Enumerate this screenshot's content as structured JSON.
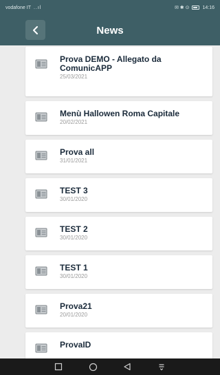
{
  "statusbar": {
    "carrier": "vodafone IT",
    "signal": "..ıl",
    "right_icons": "✉ ✱ ⊙",
    "time": "14:16"
  },
  "appbar": {
    "title": "News",
    "back_icon": "chevron-left-icon"
  },
  "news": [
    {
      "title": "Prova DEMO - Allegato da ComunicAPP",
      "date": "25/03/2021"
    },
    {
      "title": "Menù Hallowen Roma Capitale",
      "date": "20/02/2021"
    },
    {
      "title": "Prova all",
      "date": "31/01/2021"
    },
    {
      "title": "TEST 3",
      "date": "30/01/2020"
    },
    {
      "title": "TEST 2",
      "date": "30/01/2020"
    },
    {
      "title": "TEST 1",
      "date": "30/01/2020"
    },
    {
      "title": "Prova21",
      "date": "20/01/2020"
    },
    {
      "title": "ProvaID",
      "date": ""
    }
  ],
  "colors": {
    "header": "#3e5f66",
    "card": "#ffffff",
    "background": "#ececec",
    "title_text": "#1a2a3a"
  },
  "navbar_icons": [
    "square-icon",
    "circle-icon",
    "triangle-back-icon",
    "notification-icon"
  ]
}
